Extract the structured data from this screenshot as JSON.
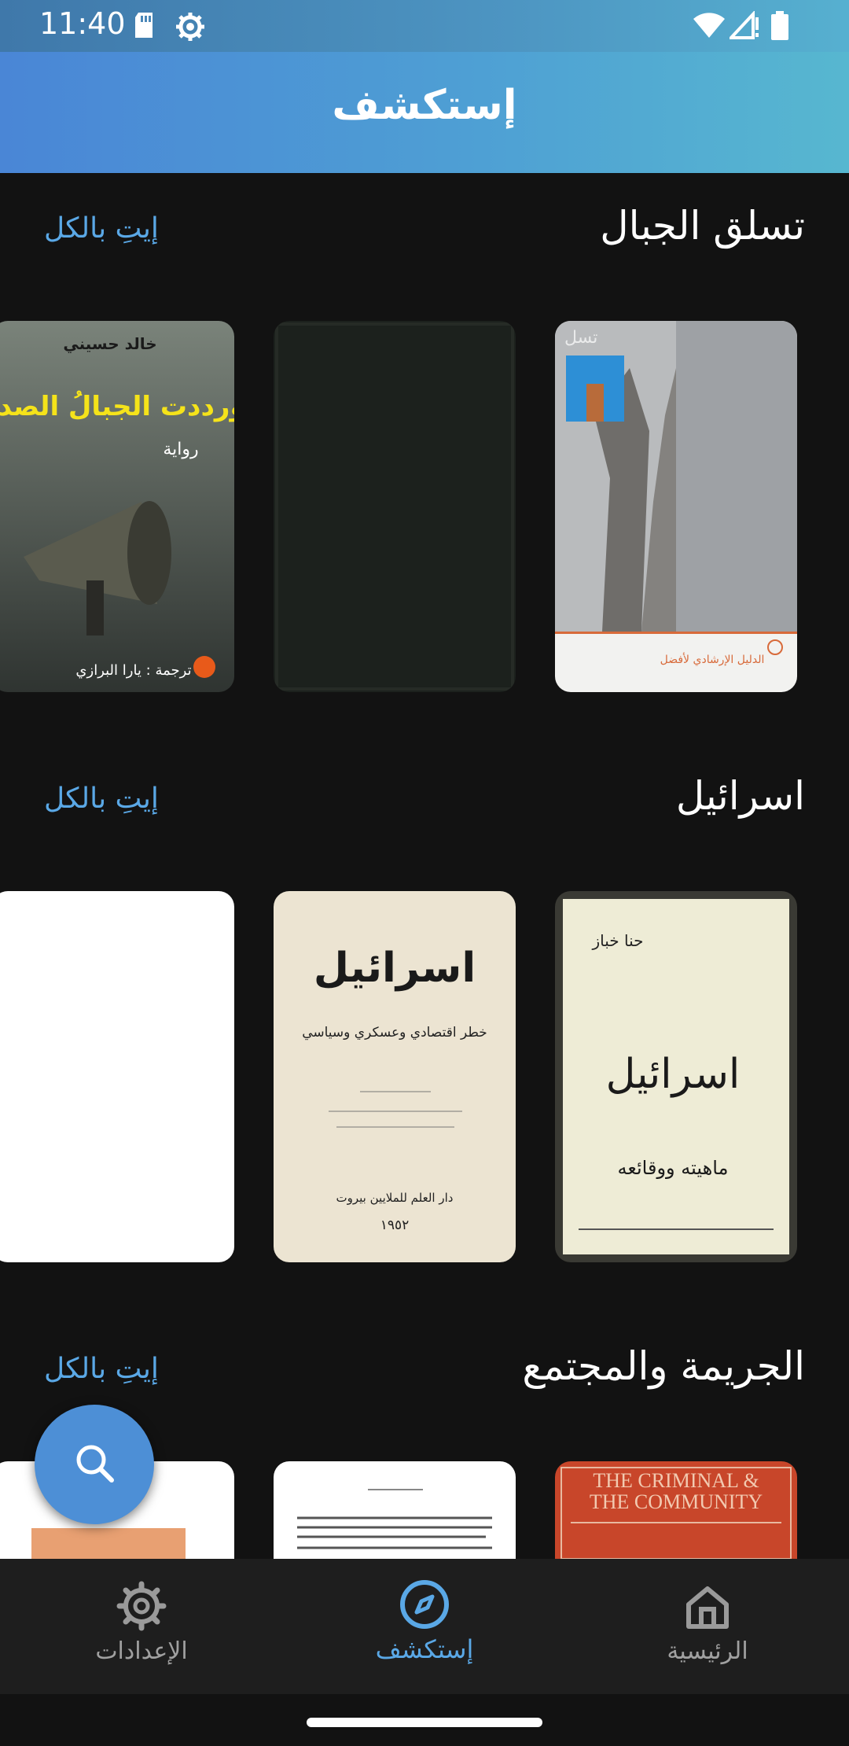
{
  "status_bar": {
    "time": "11:40",
    "icons": [
      "sd-card-icon",
      "settings-gear-icon",
      "wifi-icon",
      "signal-icon",
      "battery-icon"
    ]
  },
  "app_bar": {
    "title": "إستكشف"
  },
  "sections": [
    {
      "title": "تسلق الجبال",
      "see_all": "إيتِ بالكل",
      "books": [
        {
          "cover": "mountain-climbing-guide-cover"
        },
        {
          "cover": "dark-green-plain-cover"
        },
        {
          "cover_title": "ورددت الجبالُ الصدى",
          "author": "خالد حسيني",
          "subtitle": "رواية",
          "translator": "ترجمة : يارا البرازي"
        }
      ]
    },
    {
      "title": "اسرائيل",
      "see_all": "إيتِ بالكل",
      "books": [
        {
          "cover_title": "اسرائيل",
          "author": "حنا خباز",
          "subtitle": "ماهيته ووقائعه"
        },
        {
          "cover_title": "اسرائيل",
          "subtitle": "خطر اقتصادي وعسكري وسياسي",
          "publisher": "دار العلم للملايين بيروت",
          "year": "١٩٥٢"
        },
        {
          "cover": "blank-white-cover"
        }
      ]
    },
    {
      "title": "الجريمة والمجتمع",
      "see_all": "إيتِ بالكل",
      "books": [
        {
          "cover_title": "THE CRIMINAL & THE COMMUNITY"
        },
        {
          "cover": "text-page-cover"
        },
        {
          "cover": "orange-label-cover"
        }
      ]
    }
  ],
  "fab": {
    "icon": "search-icon"
  },
  "bottom_nav": {
    "items": [
      {
        "label": "الرئيسية",
        "icon": "home-icon",
        "active": false
      },
      {
        "label": "إستكشف",
        "icon": "compass-icon",
        "active": true
      },
      {
        "label": "الإعدادات",
        "icon": "settings-icon",
        "active": false
      }
    ]
  },
  "colors": {
    "accent": "#5aa8e6",
    "app_bar_start": "#4a86d6",
    "app_bar_end": "#57b7d0",
    "background": "#121212"
  }
}
